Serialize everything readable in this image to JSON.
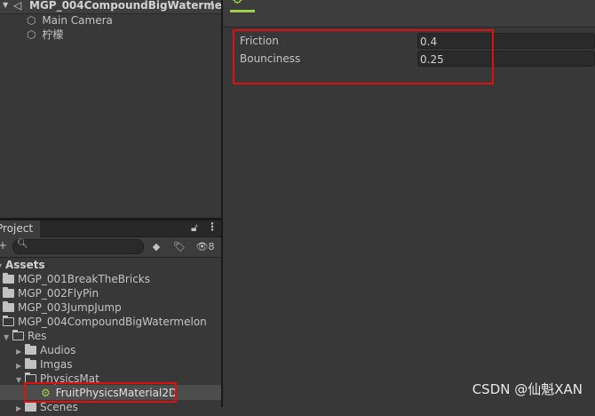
{
  "hierarchy": {
    "scene_name": "MGP_004CompoundBigWaterme",
    "items": [
      "Main Camera",
      "柠檬"
    ]
  },
  "project": {
    "tab_label": "Project",
    "hidden_count": "8",
    "root_label": "Assets",
    "tree": [
      {
        "label": "MGP_001BreakTheBricks"
      },
      {
        "label": "MGP_002FlyPin"
      },
      {
        "label": "MGP_003JumpJump"
      },
      {
        "label": "MGP_004CompoundBigWatermelon"
      },
      {
        "label": "Res"
      },
      {
        "label": "Audios"
      },
      {
        "label": "Imgas"
      },
      {
        "label": "PhysicsMat"
      },
      {
        "label": "FruitPhysicsMaterial2D"
      },
      {
        "label": "Scenes"
      }
    ]
  },
  "inspector": {
    "fields": [
      {
        "label": "Friction",
        "value": "0.4"
      },
      {
        "label": "Bounciness",
        "value": "0.25"
      }
    ]
  },
  "watermark": "CSDN @仙魁XAN",
  "colors": {
    "highlight": "#e01010",
    "accent": "#9fd14a"
  }
}
